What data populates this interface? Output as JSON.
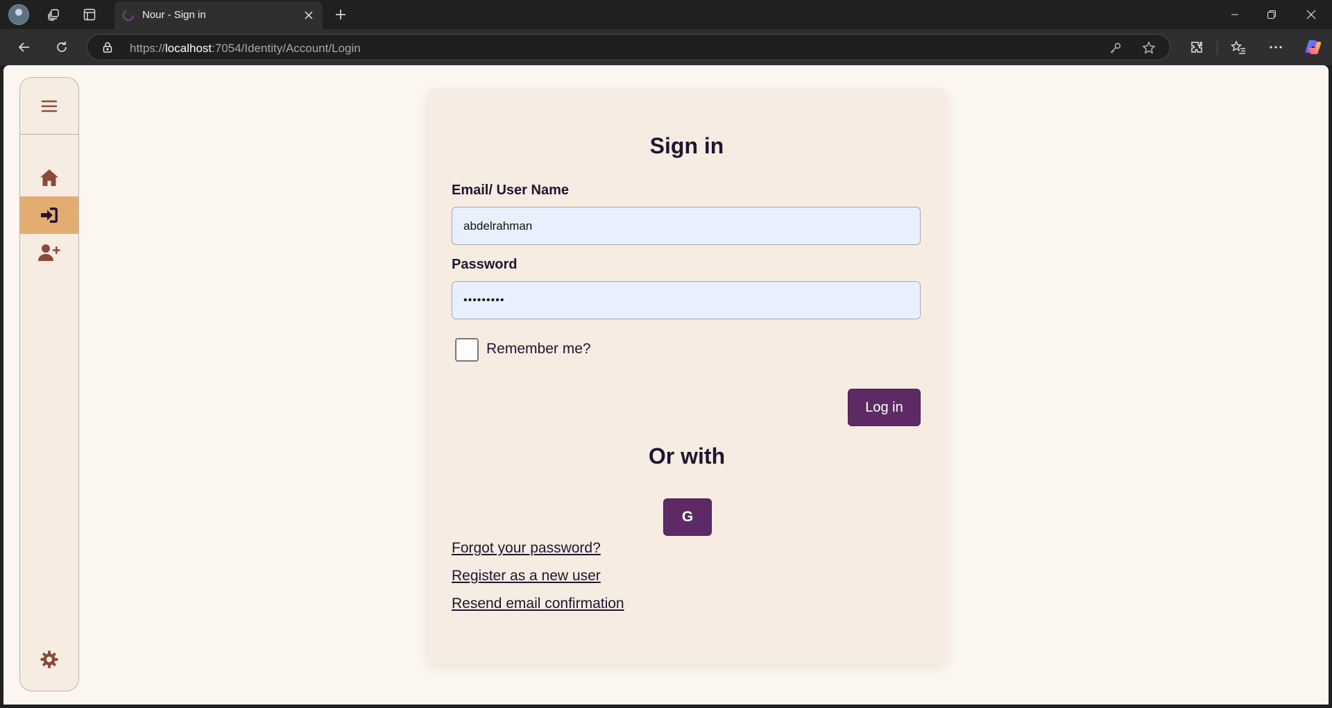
{
  "browser": {
    "tab_title": "Nour - Sign in",
    "url_scheme": "https://",
    "url_host": "localhost",
    "url_rest": ":7054/Identity/Account/Login",
    "icons": [
      "profile-avatar",
      "workspaces-icon",
      "tab-actions-icon",
      "close-tab-icon",
      "new-tab-icon",
      "minimize-icon",
      "restore-icon",
      "close-window-icon",
      "back-icon",
      "refresh-icon",
      "lock-icon",
      "key-icon",
      "star-icon",
      "extensions-icon",
      "favorites-icon",
      "more-icon",
      "copilot-icon"
    ]
  },
  "sidebar": {
    "items": [
      {
        "name": "menu",
        "icon": "hamburger-icon"
      },
      {
        "name": "home",
        "icon": "home-icon"
      },
      {
        "name": "login",
        "icon": "sign-in-icon",
        "active": true
      },
      {
        "name": "register",
        "icon": "user-plus-icon"
      },
      {
        "name": "settings",
        "icon": "gear-icon"
      }
    ],
    "colors": {
      "bg": "#f6ece1",
      "active_bg": "#e3ad72",
      "icon": "#8a4a38"
    }
  },
  "login": {
    "title": "Sign in",
    "username_label": "Email/ User Name",
    "username_value": "abdelrahman",
    "password_label": "Password",
    "password_value": "•••••••••",
    "remember_label": "Remember me?",
    "remember_checked": false,
    "login_button": "Log in",
    "or_title": "Or with",
    "google_button": "G",
    "links": {
      "forgot": "Forgot your password?",
      "register": "Register as a new user",
      "resend": "Resend email confirmation"
    }
  },
  "colors": {
    "primary": "#5e2a66",
    "page_bg": "#fbf7f0",
    "card_bg": "#f6ece1",
    "text": "#211431",
    "input_bg": "#e8f0fe"
  }
}
